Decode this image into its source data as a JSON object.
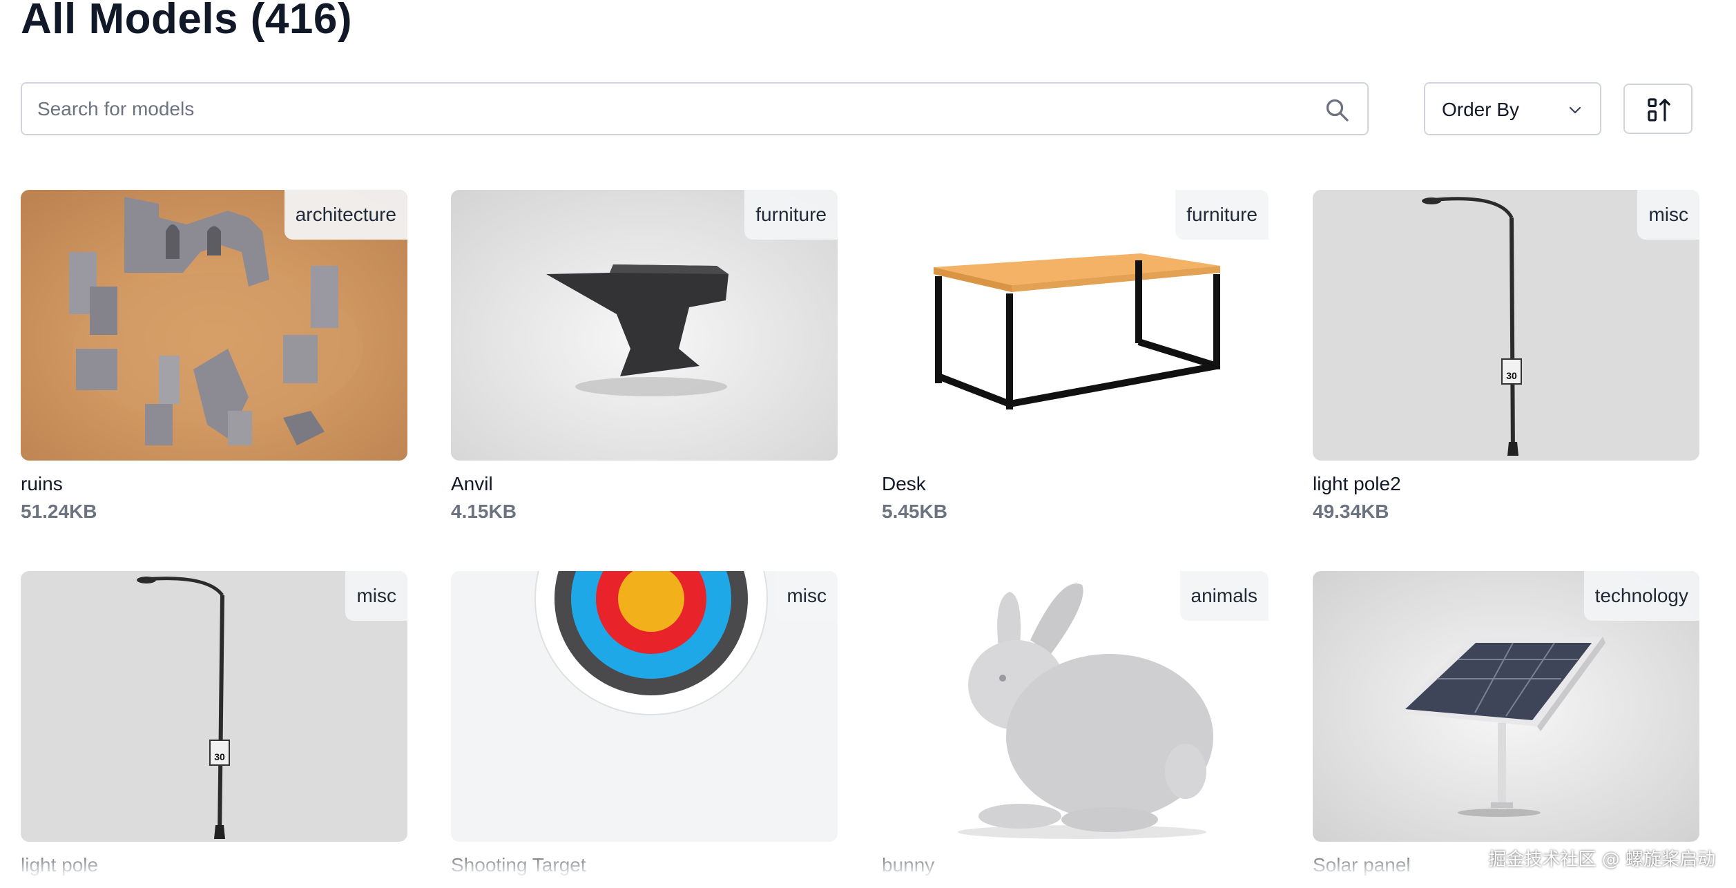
{
  "header": {
    "title": "All Models (416)"
  },
  "search": {
    "placeholder": "Search for models",
    "value": ""
  },
  "toolbar": {
    "order_by_label": "Order By"
  },
  "models": [
    {
      "name": "ruins",
      "size": "51.24KB",
      "category": "architecture"
    },
    {
      "name": "Anvil",
      "size": "4.15KB",
      "category": "furniture"
    },
    {
      "name": "Desk",
      "size": "5.45KB",
      "category": "furniture"
    },
    {
      "name": "light pole2",
      "size": "49.34KB",
      "category": "misc"
    },
    {
      "name": "light pole",
      "size": "",
      "category": "misc"
    },
    {
      "name": "Shooting Target",
      "size": "",
      "category": "misc"
    },
    {
      "name": "bunny",
      "size": "",
      "category": "animals"
    },
    {
      "name": "Solar panel",
      "size": "",
      "category": "technology"
    }
  ],
  "watermark": "掘金技术社区 @ 螺旋桨启动",
  "colors": {
    "text": "#111827",
    "muted": "#6b7280",
    "border": "#d1d5db",
    "tag_bg": "#f3f4f6"
  }
}
